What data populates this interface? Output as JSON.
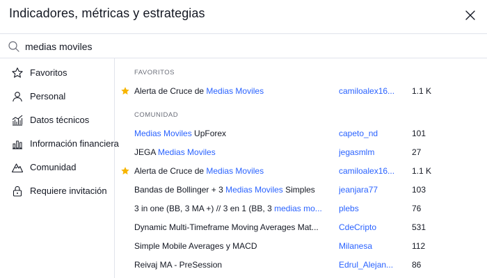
{
  "dialog": {
    "title": "Indicadores, métricas y estrategias",
    "close_icon": "close-icon"
  },
  "search": {
    "value": "medias moviles",
    "icon": "search-icon"
  },
  "sidebar": {
    "items": [
      {
        "label": "Favoritos",
        "icon": "star-outline-icon"
      },
      {
        "label": "Personal",
        "icon": "user-icon"
      },
      {
        "label": "Datos técnicos",
        "icon": "technicals-chart-icon"
      },
      {
        "label": "Información financiera",
        "icon": "bar-chart-icon"
      },
      {
        "label": "Comunidad",
        "icon": "mountain-icon"
      },
      {
        "label": "Requiere invitación",
        "icon": "lock-icon"
      }
    ]
  },
  "sections": {
    "favorites_heading": "FAVORITOS",
    "community_heading": "COMUNIDAD"
  },
  "favorites": [
    {
      "title_pre": "Alerta de Cruce de ",
      "title_hl": "Medias Moviles",
      "title_post": "",
      "author": "camiloalex16...",
      "count": "1.1 K",
      "starred": true
    }
  ],
  "community": [
    {
      "title_pre": "",
      "title_hl": "Medias Moviles",
      "title_post": " UpForex",
      "author": "capeto_nd",
      "count": "101",
      "starred": false
    },
    {
      "title_pre": "JEGA ",
      "title_hl": "Medias Moviles",
      "title_post": "",
      "author": "jegasmlm",
      "count": "27",
      "starred": false
    },
    {
      "title_pre": "Alerta de Cruce de ",
      "title_hl": "Medias Moviles",
      "title_post": "",
      "author": "camiloalex16...",
      "count": "1.1 K",
      "starred": true
    },
    {
      "title_pre": "Bandas de Bollinger + 3 ",
      "title_hl": "Medias Moviles",
      "title_post": " Simples",
      "author": "jeanjara77",
      "count": "103",
      "starred": false
    },
    {
      "title_pre": "3 in one (BB, 3 MA +) // 3 en 1 (BB, 3 ",
      "title_hl": "medias mo...",
      "title_post": "",
      "author": "plebs",
      "count": "76",
      "starred": false
    },
    {
      "title_pre": "Dynamic Multi-Timeframe Moving Averages Mat...",
      "title_hl": "",
      "title_post": "",
      "author": "CdeCripto",
      "count": "531",
      "starred": false
    },
    {
      "title_pre": "Simple Mobile Averages y MACD",
      "title_hl": "",
      "title_post": "",
      "author": "Milanesa",
      "count": "112",
      "starred": false
    },
    {
      "title_pre": "Reivaj MA - PreSession",
      "title_hl": "",
      "title_post": "",
      "author": "Edrul_Alejan...",
      "count": "86",
      "starred": false
    }
  ],
  "colors": {
    "accent": "#2962ff",
    "star": "#f7b500",
    "text": "#131722",
    "muted": "#6a6d78",
    "divider": "#e0e3eb"
  }
}
